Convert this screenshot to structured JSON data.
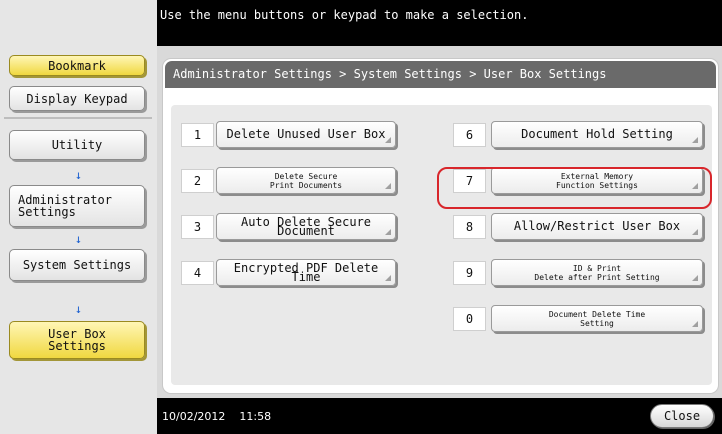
{
  "top_message": "Use the menu buttons or keypad to make a selection.",
  "sidebar": {
    "bookmark_label": "Bookmark",
    "display_keypad_label": "Display Keypad",
    "path": [
      {
        "label": "Utility"
      },
      {
        "label": "Administrator\nSettings"
      },
      {
        "label": "System Settings"
      },
      {
        "label": "User Box\nSettings"
      }
    ],
    "arrow_glyph": "↓",
    "accent_color": "#f0d840"
  },
  "breadcrumb": "Administrator Settings > System Settings > User Box Settings",
  "options": [
    {
      "number": "1",
      "label": "Delete Unused User Box"
    },
    {
      "number": "2",
      "label": "Delete Secure\nPrint Documents"
    },
    {
      "number": "3",
      "label": "Auto Delete Secure Document"
    },
    {
      "number": "4",
      "label": "Encrypted PDF Delete Time"
    },
    {
      "number": "6",
      "label": "Document Hold Setting"
    },
    {
      "number": "7",
      "label": "External Memory\nFunction Settings"
    },
    {
      "number": "8",
      "label": "Allow/Restrict User Box"
    },
    {
      "number": "9",
      "label": "ID & Print\nDelete after Print Setting"
    },
    {
      "number": "0",
      "label": "Document Delete Time\nSetting"
    }
  ],
  "highlight_color": "#d8262b",
  "status": {
    "date": "10/02/2012",
    "time": "11:58"
  },
  "close_label": "Close"
}
